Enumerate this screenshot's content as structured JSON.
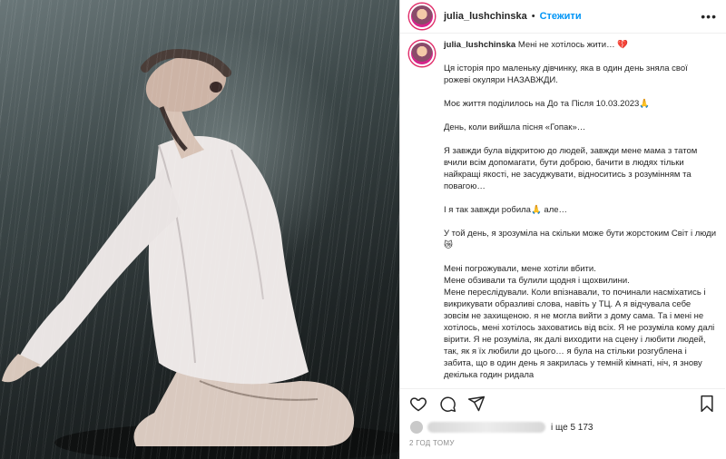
{
  "post": {
    "username": "julia_lushchinska",
    "separator": "•",
    "follow_label": "Стежити",
    "more_label": "•••"
  },
  "caption": {
    "username": "julia_lushchinska",
    "text": "Мені не хотілось жити… 💔\n\nЦя історія про маленьку дівчинку, яка в один день зняла свої рожеві окуляри НАЗАВЖДИ.\n\nМоє життя поділилось на До та Після 10.03.2023🙏\n\nДень, коли вийшла пісня «Гопак»…\n\nЯ завжди була відкритою до людей, завжди мене мама з татом вчили всім допомагати, бути доброю, бачити в людях тільки найкращі якості, не засуджувати, відноситись з розумінням та повагою…\n\nІ я так завжди робила🙏 але…\n\nУ той день, я зрозуміла на скільки може бути жорстоким Світ і люди 😿\n\nМені погрожували, мене хотіли вбити.\nМене обзивали та булили щодня і щохвилини.\nМене переслідували. Коли впізнавали, то починали насміхатись і викрикувати образливі слова, навіть у ТЦ. А я відчувала себе зовсім не захищеною. я не могла вийти з дому сама. Та і мені не хотілось, мені хотілось заховатись від всіх. Я не розуміла кому далі вірити. Я не розуміла, як далі виходити на сцену і любити людей, так, як я їх любили до цього… я була на стільки розгублена і забита, що в один день я закрилась у темній кімнаті, ніч, я знову декілька годин ридала"
  },
  "icons": {
    "like": "heart-icon",
    "comment": "comment-icon",
    "share": "share-icon",
    "save": "bookmark-icon"
  },
  "likes": {
    "text": "і ще 5 173"
  },
  "timestamp": "2 ГОД ТОМУ",
  "colors": {
    "accent": "#0095f6",
    "text": "#262626",
    "muted": "#8e8e8e",
    "border": "#dbdbdb"
  }
}
